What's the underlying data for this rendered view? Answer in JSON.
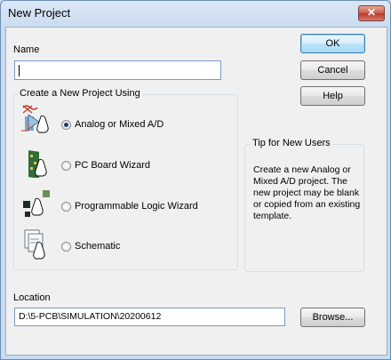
{
  "window": {
    "title": "New Project",
    "close_glyph": "✕"
  },
  "name_field": {
    "label": "Name",
    "value": ""
  },
  "buttons": {
    "ok": "OK",
    "cancel": "Cancel",
    "help": "Help",
    "browse": "Browse..."
  },
  "group": {
    "caption": "Create a New Project Using",
    "options": [
      {
        "label": "Analog or Mixed A/D",
        "selected": true,
        "icon": "analog-mixed-icon"
      },
      {
        "label": "PC Board Wizard",
        "selected": false,
        "icon": "pcb-wizard-icon"
      },
      {
        "label": "Programmable Logic Wizard",
        "selected": false,
        "icon": "programmable-logic-icon"
      },
      {
        "label": "Schematic",
        "selected": false,
        "icon": "schematic-icon"
      }
    ]
  },
  "tip": {
    "caption": "Tip for New Users",
    "text": "Create a new Analog or Mixed A/D project.  The new project may be blank or copied from an existing template."
  },
  "location": {
    "label": "Location",
    "value": "D:\\5-PCB\\SIMULATION\\20200612"
  },
  "colors": {
    "title_bg": "#c9dcf0",
    "client_bg": "#f0f0f0",
    "close": "#c8584a"
  }
}
